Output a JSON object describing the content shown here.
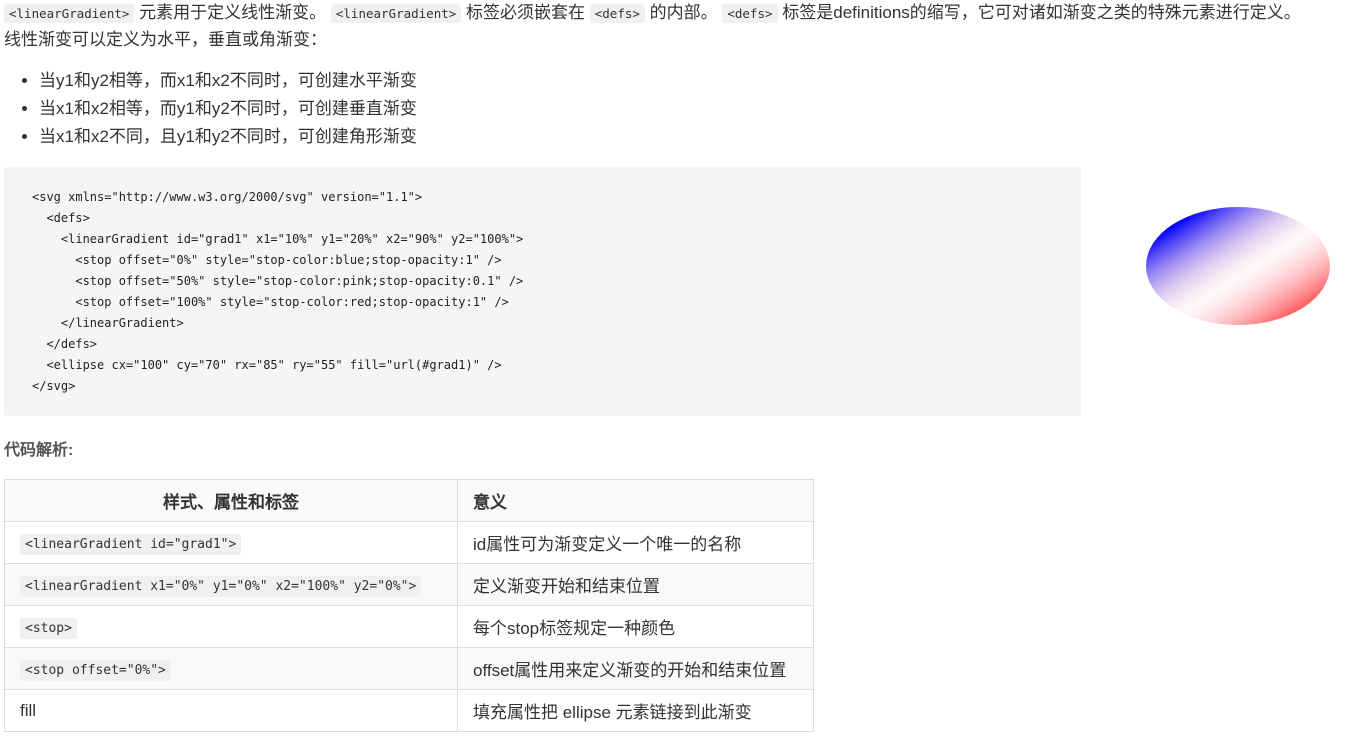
{
  "intro": {
    "code1": "<linearGradient>",
    "text1": " 元素用于定义线性渐变。 ",
    "code2": "<linearGradient>",
    "text2": " 标签必须嵌套在 ",
    "code3": "<defs>",
    "text3": " 的内部。 ",
    "code4": "<defs>",
    "text4": " 标签是definitions的缩写，它可对诸如渐变之类的特殊元素进行定义。",
    "line2": "线性渐变可以定义为水平，垂直或角渐变："
  },
  "points": [
    "当y1和y2相等，而x1和x2不同时，可创建水平渐变",
    "当x1和x2相等，而y1和y2不同时，可创建垂直渐变",
    "当x1和x2不同，且y1和y2不同时，可创建角形渐变"
  ],
  "code_lines": [
    "<svg xmlns=\"http://www.w3.org/2000/svg\" version=\"1.1\">",
    "  <defs>",
    "    <linearGradient id=\"grad1\" x1=\"10%\" y1=\"20%\" x2=\"90%\" y2=\"100%\">",
    "      <stop offset=\"0%\" style=\"stop-color:blue;stop-opacity:1\" />",
    "      <stop offset=\"50%\" style=\"stop-color:pink;stop-opacity:0.1\" />",
    "      <stop offset=\"100%\" style=\"stop-color:red;stop-opacity:1\" />",
    "    </linearGradient>",
    "  </defs>",
    "  <ellipse cx=\"100\" cy=\"70\" rx=\"85\" ry=\"55\" fill=\"url(#grad1)\" />",
    "</svg>"
  ],
  "preview_colors": {
    "start": "#0000ff",
    "middle": "#ffc0cb",
    "end": "#ff0000"
  },
  "analysis_title": "代码解析:",
  "table": {
    "headers": [
      "样式、属性和标签",
      "意义"
    ],
    "rows": [
      {
        "code": "<linearGradient id=\"grad1\">",
        "meaning": "id属性可为渐变定义一个唯一的名称"
      },
      {
        "code": "<linearGradient x1=\"0%\" y1=\"0%\" x2=\"100%\" y2=\"0%\">",
        "meaning": "定义渐变开始和结束位置"
      },
      {
        "code": "<stop>",
        "meaning": "每个stop标签规定一种颜色"
      },
      {
        "code": "<stop offset=\"0%\">",
        "meaning": "offset属性用来定义渐变的开始和结束位置"
      },
      {
        "plain": "fill",
        "meaning": "填充属性把 ellipse 元素链接到此渐变"
      }
    ]
  }
}
